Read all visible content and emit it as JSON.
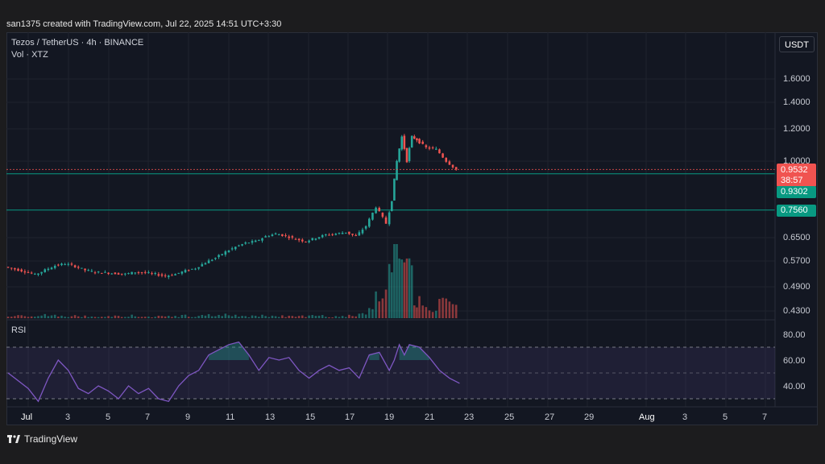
{
  "header": {
    "attribution": "san1375 created with TradingView.com, Jul 22, 2025 14:51 UTC+3:30"
  },
  "legend": {
    "title": "Tezos / TetherUS · 4h · BINANCE",
    "volume": "Vol · XTZ"
  },
  "currency_button": "USDT",
  "rsi_pane": {
    "label": "RSI",
    "ticks": [
      "80.00",
      "60.00",
      "40.00"
    ]
  },
  "price_axis": {
    "ticks": [
      "1.6000",
      "1.4000",
      "1.2000",
      "1.0000",
      "0.6500",
      "0.5700",
      "0.4900",
      "0.4300"
    ]
  },
  "price_tags": {
    "last_price": "0.9532",
    "countdown": "38:57",
    "level_1": "0.9302",
    "level_2": "0.7560"
  },
  "time_axis": {
    "labels": [
      "Jul",
      "3",
      "5",
      "7",
      "9",
      "11",
      "13",
      "15",
      "17",
      "19",
      "21",
      "23",
      "25",
      "27",
      "29",
      "Aug",
      "3",
      "5",
      "7"
    ]
  },
  "brand": {
    "name": "TradingView"
  },
  "colors": {
    "up": "#26a69a",
    "down": "#ef5350",
    "rsi": "#7e57c2",
    "level": "#089981",
    "background": "#131722"
  },
  "chart_data": {
    "type": "candlestick",
    "symbol": "Tezos / TetherUS",
    "interval": "4h",
    "exchange": "BINANCE",
    "scale": "log",
    "price_range": [
      0.42,
      1.75
    ],
    "time_range": [
      "Jun 30",
      "Aug 8"
    ],
    "close_series": [
      [
        "Jun 30",
        0.546
      ],
      [
        "Jul 1",
        0.532
      ],
      [
        "Jul 1.5",
        0.522
      ],
      [
        "Jul 2",
        0.536
      ],
      [
        "Jul 2.5",
        0.55
      ],
      [
        "Jul 3",
        0.556
      ],
      [
        "Jul 3.5",
        0.548
      ],
      [
        "Jul 4",
        0.536
      ],
      [
        "Jul 4.5",
        0.53
      ],
      [
        "Jul 5",
        0.528
      ],
      [
        "Jul 5.5",
        0.526
      ],
      [
        "Jul 6",
        0.524
      ],
      [
        "Jul 6.5",
        0.53
      ],
      [
        "Jul 7",
        0.528
      ],
      [
        "Jul 7.5",
        0.524
      ],
      [
        "Jul 8",
        0.518
      ],
      [
        "Jul 8.5",
        0.524
      ],
      [
        "Jul 9",
        0.534
      ],
      [
        "Jul 9.5",
        0.542
      ],
      [
        "Jul 10",
        0.56
      ],
      [
        "Jul 10.5",
        0.575
      ],
      [
        "Jul 11",
        0.595
      ],
      [
        "Jul 11.5",
        0.612
      ],
      [
        "Jul 12",
        0.626
      ],
      [
        "Jul 12.5",
        0.632
      ],
      [
        "Jul 13",
        0.65
      ],
      [
        "Jul 13.5",
        0.66
      ],
      [
        "Jul 14",
        0.652
      ],
      [
        "Jul 14.5",
        0.64
      ],
      [
        "Jul 15",
        0.632
      ],
      [
        "Jul 15.5",
        0.645
      ],
      [
        "Jul 16",
        0.656
      ],
      [
        "Jul 16.5",
        0.66
      ],
      [
        "Jul 17",
        0.666
      ],
      [
        "Jul 17.5",
        0.65
      ],
      [
        "Jul 18",
        0.69
      ],
      [
        "Jul 18.5",
        0.77
      ],
      [
        "Jul 19",
        0.7
      ],
      [
        "Jul 19.25",
        0.8
      ],
      [
        "Jul 19.5",
        1.0
      ],
      [
        "Jul 19.75",
        1.15
      ],
      [
        "Jul 20",
        1.0
      ],
      [
        "Jul 20.25",
        1.15
      ],
      [
        "Jul 20.5",
        1.13
      ],
      [
        "Jul 21",
        1.08
      ],
      [
        "Jul 21.5",
        1.07
      ],
      [
        "Jul 22",
        1.0
      ],
      [
        "Jul 22.5",
        0.953
      ]
    ],
    "last_price": 0.9532,
    "horizontal_levels": [
      0.9302,
      0.756
    ],
    "volume_peaks": [
      [
        "Jul 19.25",
        "high"
      ],
      [
        "Jul 20.25",
        "highest"
      ]
    ],
    "rsi": {
      "range": [
        20,
        100
      ],
      "overbought": 70,
      "oversold": 30,
      "values": [
        [
          "Jun 30",
          60
        ],
        [
          "Jul 1",
          48
        ],
        [
          "Jul 1.5",
          38
        ],
        [
          "Jul 2",
          56
        ],
        [
          "Jul 2.5",
          70
        ],
        [
          "Jul 3",
          62
        ],
        [
          "Jul 3.5",
          48
        ],
        [
          "Jul 4",
          44
        ],
        [
          "Jul 4.5",
          50
        ],
        [
          "Jul 5",
          46
        ],
        [
          "Jul 5.5",
          40
        ],
        [
          "Jul 6",
          50
        ],
        [
          "Jul 6.5",
          44
        ],
        [
          "Jul 7",
          48
        ],
        [
          "Jul 7.5",
          40
        ],
        [
          "Jul 8",
          38
        ],
        [
          "Jul 8.5",
          50
        ],
        [
          "Jul 9",
          58
        ],
        [
          "Jul 9.5",
          62
        ],
        [
          "Jul 10",
          74
        ],
        [
          "Jul 10.5",
          78
        ],
        [
          "Jul 11",
          82
        ],
        [
          "Jul 11.5",
          84
        ],
        [
          "Jul 12",
          74
        ],
        [
          "Jul 12.5",
          62
        ],
        [
          "Jul 13",
          72
        ],
        [
          "Jul 13.5",
          70
        ],
        [
          "Jul 14",
          72
        ],
        [
          "Jul 14.5",
          62
        ],
        [
          "Jul 15",
          56
        ],
        [
          "Jul 15.5",
          62
        ],
        [
          "Jul 16",
          66
        ],
        [
          "Jul 16.5",
          62
        ],
        [
          "Jul 17",
          64
        ],
        [
          "Jul 17.5",
          56
        ],
        [
          "Jul 18",
          74
        ],
        [
          "Jul 18.5",
          76
        ],
        [
          "Jul 19",
          62
        ],
        [
          "Jul 19.25",
          70
        ],
        [
          "Jul 19.5",
          82
        ],
        [
          "Jul 19.75",
          74
        ],
        [
          "Jul 20",
          82
        ],
        [
          "Jul 20.5",
          80
        ],
        [
          "Jul 21",
          72
        ],
        [
          "Jul 21.5",
          62
        ],
        [
          "Jul 22",
          56
        ],
        [
          "Jul 22.5",
          52
        ]
      ]
    }
  }
}
